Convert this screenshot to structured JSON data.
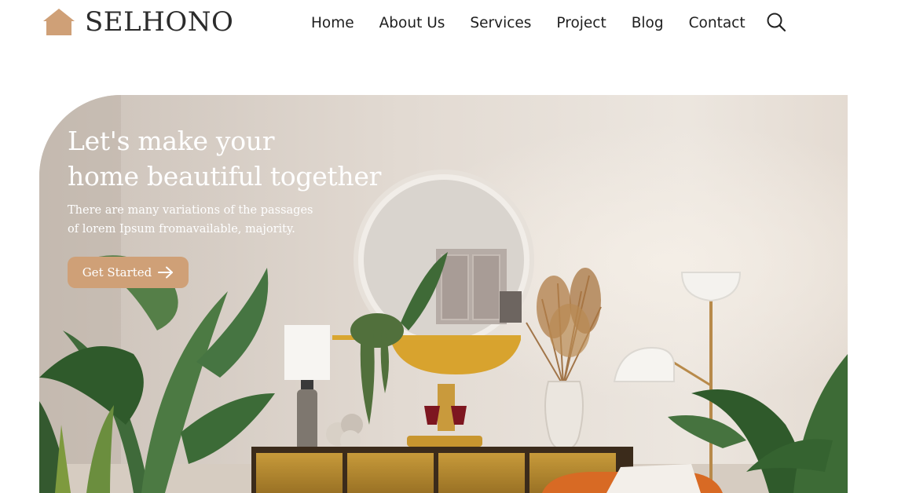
{
  "brand": {
    "name": "SELHONO",
    "logo_icon": "house-icon",
    "accent": "#cfa077"
  },
  "nav": {
    "items": [
      "Home",
      "About Us",
      "Services",
      "Project",
      "Blog",
      "Contact"
    ],
    "search_icon": "search-icon"
  },
  "hero": {
    "title_line1": "Let's make your",
    "title_line2": "home beautiful together",
    "subtitle_line1": "There are many variations of the passages",
    "subtitle_line2": "of lorem Ipsum fromavailable, majority.",
    "cta_label": "Get Started",
    "cta_icon": "arrow-right-icon",
    "cta_color": "#cfa077"
  }
}
